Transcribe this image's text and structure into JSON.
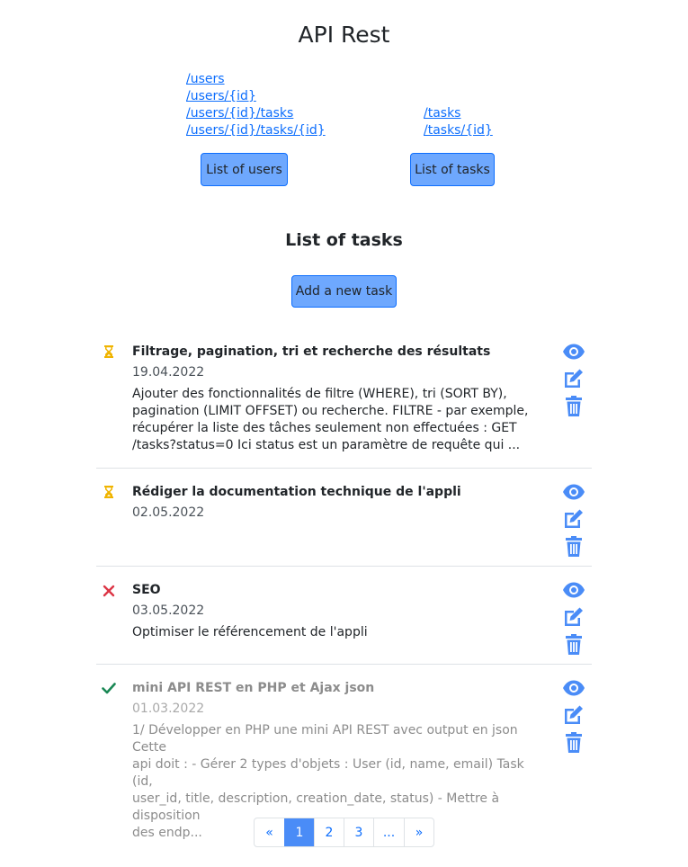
{
  "header": {
    "title": "API Rest"
  },
  "endpoints": {
    "left": [
      "/users",
      "/users/{id}",
      "/users/{id}/tasks",
      "/users/{id}/tasks/{id}"
    ],
    "right": [
      "/tasks",
      "/tasks/{id}"
    ]
  },
  "buttons": {
    "list_users": "List of users",
    "list_tasks": "List of tasks",
    "add_task": "Add a new task"
  },
  "section": {
    "title": "List of tasks"
  },
  "tasks": [
    {
      "status": "pending",
      "status_icon": "hourglass-icon",
      "title": "Filtrage, pagination, tri et recherche des résultats",
      "date": "19.04.2022",
      "desc_lines": [
        "Ajouter des fonctionnalités de filtre (WHERE), tri (SORT BY),",
        "pagination (LIMIT OFFSET) ou recherche. FILTRE - par exemple,",
        "récupérer la liste des tâches seulement non effectuées : GET",
        "/tasks?status=0 Ici status est un paramètre de requête qui ..."
      ]
    },
    {
      "status": "pending",
      "status_icon": "hourglass-icon",
      "title": "Rédiger la documentation technique de l'appli",
      "date": "02.05.2022",
      "desc_lines": []
    },
    {
      "status": "cancelled",
      "status_icon": "cross-icon",
      "title": "SEO",
      "date": "03.05.2022",
      "desc_lines": [
        "Optimiser le référencement de l'appli"
      ]
    },
    {
      "status": "done",
      "status_icon": "check-icon",
      "title": "mini API REST en PHP et Ajax json",
      "date": "01.03.2022",
      "desc_lines": [
        "1/ Développer en PHP une mini API REST avec output en json Cette",
        "api doit : - Gérer 2 types d'objets : User (id, name, email) Task (id,",
        "user_id, title, description, creation_date, status) - Mettre à disposition",
        "des endp..."
      ]
    }
  ],
  "pagination": {
    "items": [
      "«",
      "1",
      "2",
      "3",
      "...",
      "»"
    ],
    "active": "1"
  },
  "colors": {
    "accent": "#4a8cf7",
    "pending": "#f0b400",
    "cancelled": "#dc3545",
    "done": "#198754",
    "action": "#4a8cf7"
  }
}
